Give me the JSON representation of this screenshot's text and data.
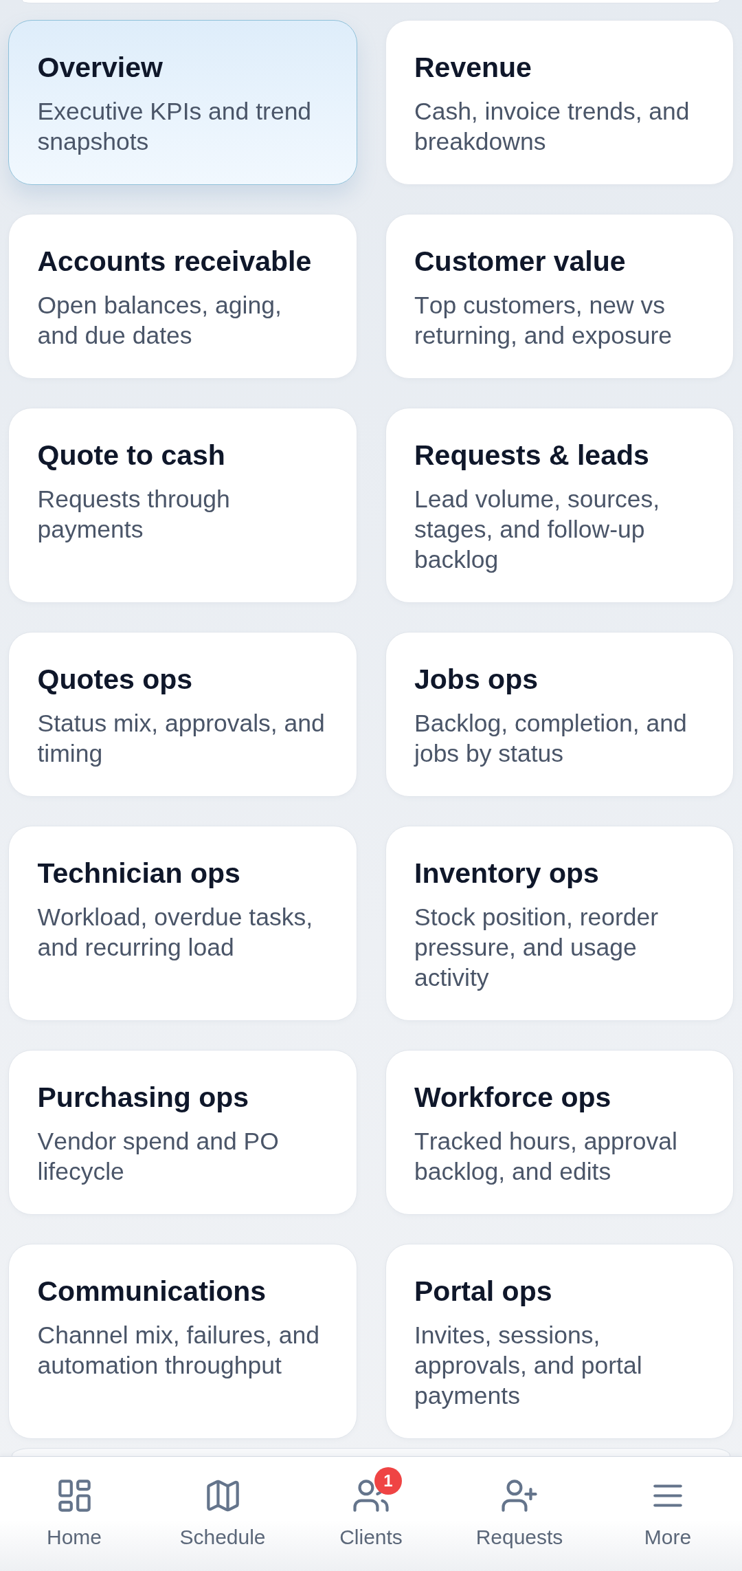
{
  "cards": [
    {
      "title": "Overview",
      "description": "Executive KPIs and trend snapshots",
      "selected": true
    },
    {
      "title": "Revenue",
      "description": "Cash, invoice trends, and breakdowns",
      "selected": false
    },
    {
      "title": "Accounts receivable",
      "description": "Open balances, aging, and due dates",
      "selected": false
    },
    {
      "title": "Customer value",
      "description": "Top customers, new vs returning, and exposure",
      "selected": false
    },
    {
      "title": "Quote to cash",
      "description": "Requests through payments",
      "selected": false
    },
    {
      "title": "Requests & leads",
      "description": "Lead volume, sources, stages, and follow-up backlog",
      "selected": false
    },
    {
      "title": "Quotes ops",
      "description": "Status mix, approvals, and timing",
      "selected": false
    },
    {
      "title": "Jobs ops",
      "description": "Backlog, completion, and jobs by status",
      "selected": false
    },
    {
      "title": "Technician ops",
      "description": "Workload, overdue tasks, and recurring load",
      "selected": false
    },
    {
      "title": "Inventory ops",
      "description": "Stock position, reorder pressure, and usage activity",
      "selected": false
    },
    {
      "title": "Purchasing ops",
      "description": "Vendor spend and PO lifecycle",
      "selected": false
    },
    {
      "title": "Workforce ops",
      "description": "Tracked hours, approval backlog, and edits",
      "selected": false
    },
    {
      "title": "Communications",
      "description": "Channel mix, failures, and automation throughput",
      "selected": false
    },
    {
      "title": "Portal ops",
      "description": "Invites, sessions, approvals, and portal payments",
      "selected": false
    }
  ],
  "bottom_nav": {
    "items": [
      {
        "label": "Home"
      },
      {
        "label": "Schedule"
      },
      {
        "label": "Clients",
        "badge": "1"
      },
      {
        "label": "Requests"
      },
      {
        "label": "More"
      }
    ]
  }
}
